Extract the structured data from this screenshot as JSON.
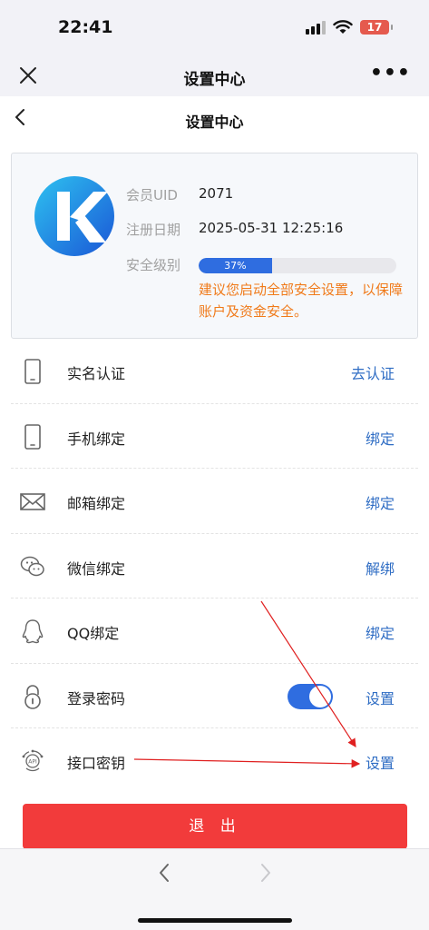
{
  "status_bar": {
    "time": "22:41",
    "battery": "17"
  },
  "browser": {
    "title": "设置中心",
    "more": "•••"
  },
  "page": {
    "title": "设置中心"
  },
  "member": {
    "uid_label": "会员UID",
    "uid_value": "2071",
    "reg_label": "注册日期",
    "reg_value": "2025-05-31 12:25:16",
    "security_label": "安全级别",
    "security_level": 0.37,
    "security_percent": "37%",
    "warning": "建议您启动全部安全设置，以保障账户及资金安全。"
  },
  "rows": [
    {
      "icon": "phone-icon",
      "label": "实名认证",
      "action": "去认证"
    },
    {
      "icon": "phone-icon",
      "label": "手机绑定",
      "action": "绑定"
    },
    {
      "icon": "mail-icon",
      "label": "邮箱绑定",
      "action": "绑定"
    },
    {
      "icon": "wechat-icon",
      "label": "微信绑定",
      "action": "解绑"
    },
    {
      "icon": "qq-icon",
      "label": "QQ绑定",
      "action": "绑定"
    },
    {
      "icon": "lock-icon",
      "label": "登录密码",
      "action": "设置",
      "toggle": true
    },
    {
      "icon": "api-icon",
      "label": "接口密钥",
      "action": "设置"
    }
  ],
  "logout": "退 出",
  "colors": {
    "accent": "#2f6de0",
    "danger": "#f23b3b",
    "warning": "#f07a1a",
    "annotation": "#e02020"
  }
}
